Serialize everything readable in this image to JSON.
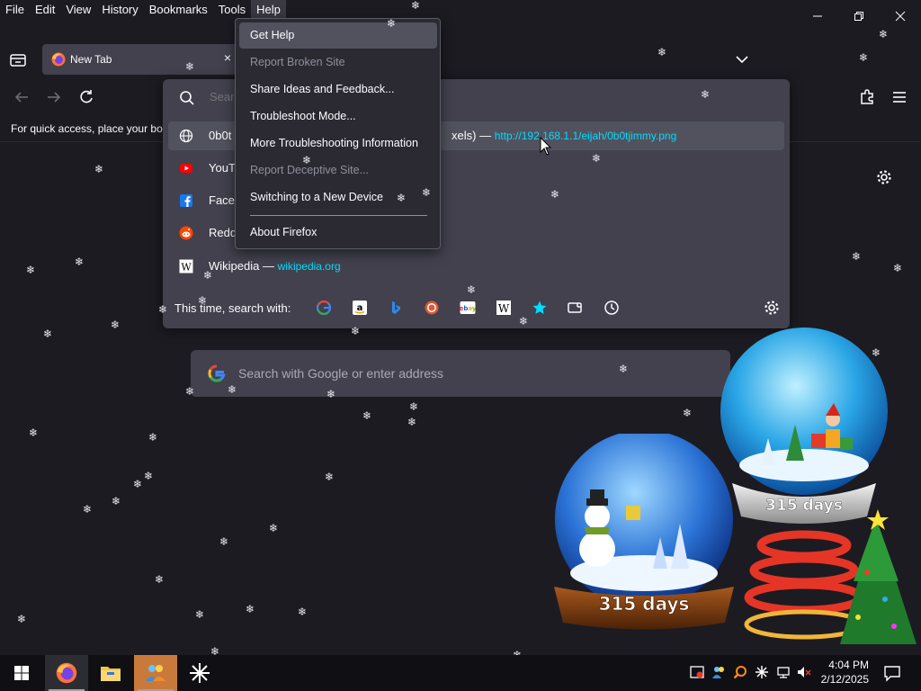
{
  "menubar": {
    "items": [
      "File",
      "Edit",
      "View",
      "History",
      "Bookmarks",
      "Tools",
      "Help"
    ]
  },
  "tab": {
    "title": "New Tab",
    "close": "×"
  },
  "bookmarks_hint": "For quick access, place your boo",
  "urlbar": {
    "placeholder": "Search",
    "rows": [
      {
        "title": "0b0t",
        "tail": "xels)",
        "sep": "—",
        "url": "http://192.168.1.1/eijah/0b0tjimmy.png"
      },
      {
        "title": "YouT"
      },
      {
        "title": "Face"
      },
      {
        "title": "Redd"
      },
      {
        "title": "Wikipedia",
        "sep": "—",
        "url": "wikipedia.org"
      }
    ],
    "oneoff_label": "This time, search with:"
  },
  "help_menu": {
    "items": [
      {
        "label": "Get Help",
        "state": "hover"
      },
      {
        "label": "Report Broken Site",
        "state": "disabled"
      },
      {
        "label": "Share Ideas and Feedback...",
        "state": "normal"
      },
      {
        "label": "Troubleshoot Mode...",
        "state": "normal"
      },
      {
        "label": "More Troubleshooting Information",
        "state": "normal"
      },
      {
        "label": "Report Deceptive Site...",
        "state": "disabled"
      },
      {
        "label": "Switching to a New Device",
        "state": "normal"
      },
      {
        "label": "About Firefox",
        "state": "normal"
      }
    ]
  },
  "newtab": {
    "search_placeholder": "Search with Google or enter address"
  },
  "widget": {
    "left_globe_days": "315 days",
    "right_globe_days": "315 days"
  },
  "taskbar": {
    "time": "4:04 PM",
    "date": "2/12/2025"
  },
  "colors": {
    "background": "#1c1b22",
    "panel": "#42414d",
    "menu": "#2b2a33",
    "accent_link": "#00ddff"
  }
}
